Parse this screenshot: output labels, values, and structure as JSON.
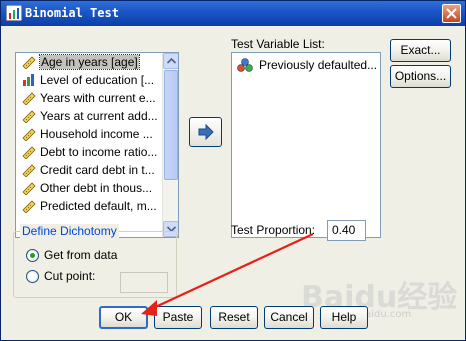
{
  "window": {
    "title": "Binomial Test",
    "close_glyph": "×"
  },
  "source_list": {
    "items": [
      {
        "label": "Age in years [age]",
        "icon": "ruler-icon",
        "selected": true
      },
      {
        "label": "Level of education [...",
        "icon": "bar-chart-icon",
        "selected": false
      },
      {
        "label": "Years with current e...",
        "icon": "ruler-icon",
        "selected": false
      },
      {
        "label": "Years at current add...",
        "icon": "ruler-icon",
        "selected": false
      },
      {
        "label": "Household income ...",
        "icon": "ruler-icon",
        "selected": false
      },
      {
        "label": "Debt to income ratio...",
        "icon": "ruler-icon",
        "selected": false
      },
      {
        "label": "Credit card debt in t...",
        "icon": "ruler-icon",
        "selected": false
      },
      {
        "label": "Other debt in thous...",
        "icon": "ruler-icon",
        "selected": false
      },
      {
        "label": "Predicted default, m...",
        "icon": "ruler-icon",
        "selected": false
      }
    ]
  },
  "test_variable_list": {
    "label": "Test Variable List:",
    "items": [
      {
        "label": "Previously defaulted...",
        "icon": "nominal-circles-icon"
      }
    ]
  },
  "side_buttons": {
    "exact": "Exact...",
    "options": "Options..."
  },
  "test_proportion": {
    "label": "Test Proportion:",
    "value": "0.40"
  },
  "define_dichotomy": {
    "title": "Define Dichotomy",
    "get_from_data": "Get from data",
    "cut_point": "Cut point:",
    "selected": "get_from_data"
  },
  "bottom_buttons": {
    "ok": "OK",
    "paste": "Paste",
    "reset": "Reset",
    "cancel": "Cancel",
    "help": "Help"
  },
  "watermark": {
    "text": "Baidu经验",
    "sub": "jingyan.baidu.com"
  },
  "colors": {
    "title_bar": "#1d57c7",
    "annotation_arrow": "#e8201a",
    "radio_dot": "#21a121"
  }
}
